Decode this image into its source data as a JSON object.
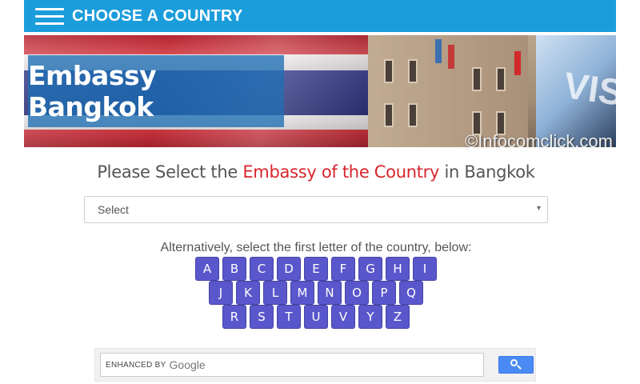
{
  "nav": {
    "title": "CHOOSE A COUNTRY",
    "menu_icon": "hamburger-menu-icon"
  },
  "banner": {
    "title": "Embassy Bangkok",
    "watermark": "©Infocomclick.com"
  },
  "heading": {
    "prefix": "Please Select the ",
    "accent": "Embassy of the Country",
    "suffix": " in Bangkok"
  },
  "select": {
    "value": "Select",
    "arrow": "▾"
  },
  "alphabet": {
    "instruction": "Alternatively, select the first letter of the country, below:",
    "row1": [
      "A",
      "B",
      "C",
      "D",
      "E",
      "F",
      "G",
      "H",
      "I"
    ],
    "row2": [
      "J",
      "K",
      "L",
      "M",
      "N",
      "O",
      "P",
      "Q"
    ],
    "row3": [
      "R",
      "S",
      "T",
      "U",
      "V",
      "Y",
      "Z"
    ]
  },
  "search": {
    "enhanced_label": "ENHANCED BY",
    "google_label": "Google",
    "button_icon": "search-icon"
  },
  "colors": {
    "nav_bg": "#1b9ddc",
    "accent_red": "#d9262c",
    "letter_bg": "#5a57cc",
    "search_btn": "#4a8af4"
  }
}
